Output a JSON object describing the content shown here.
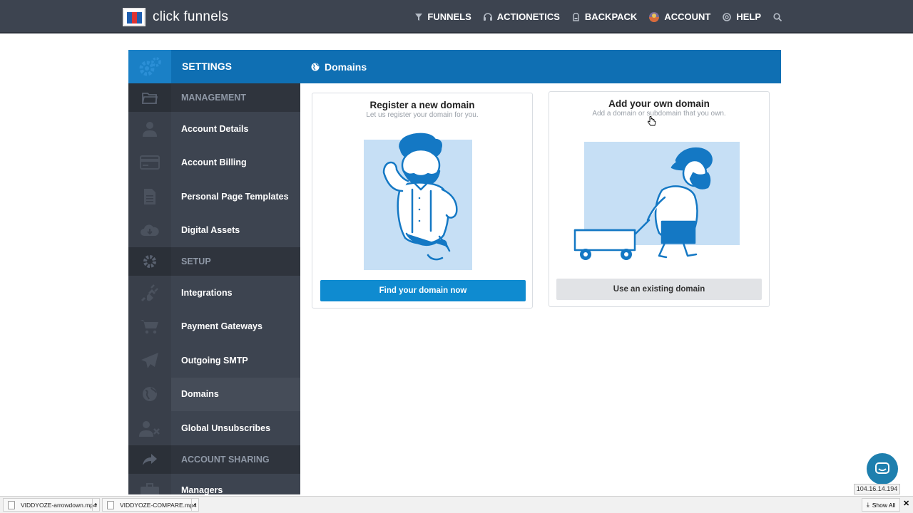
{
  "brand": {
    "logo_text": "click funnels"
  },
  "topnav": {
    "items": [
      {
        "label": "FUNNELS",
        "icon": "funnel-icon"
      },
      {
        "label": "ACTIONETICS",
        "icon": "headset-icon"
      },
      {
        "label": "BACKPACK",
        "icon": "backpack-icon"
      },
      {
        "label": "ACCOUNT",
        "icon": "avatar-icon"
      },
      {
        "label": "HELP",
        "icon": "lifebuoy-icon"
      }
    ],
    "search_icon": "search-icon"
  },
  "panel": {
    "title": "SETTINGS",
    "section_title": "Domains"
  },
  "sidebar": {
    "items": [
      {
        "label": "MANAGEMENT",
        "type": "section",
        "icon": "folder-icon"
      },
      {
        "label": "Account Details",
        "type": "item",
        "icon": "user-icon"
      },
      {
        "label": "Account Billing",
        "type": "item",
        "icon": "credit-card-icon"
      },
      {
        "label": "Personal Page Templates",
        "type": "item",
        "icon": "document-icon"
      },
      {
        "label": "Digital Assets",
        "type": "item",
        "icon": "cloud-download-icon"
      },
      {
        "label": "SETUP",
        "type": "section",
        "icon": "gear-icon"
      },
      {
        "label": "Integrations",
        "type": "item",
        "icon": "plug-icon"
      },
      {
        "label": "Payment Gateways",
        "type": "item",
        "icon": "cart-icon"
      },
      {
        "label": "Outgoing SMTP",
        "type": "item",
        "icon": "paper-plane-icon"
      },
      {
        "label": "Domains",
        "type": "item",
        "icon": "globe-icon",
        "active": true
      },
      {
        "label": "Global Unsubscribes",
        "type": "item",
        "icon": "user-remove-icon"
      },
      {
        "label": "ACCOUNT SHARING",
        "type": "section",
        "icon": "share-icon"
      },
      {
        "label": "Managers",
        "type": "item",
        "icon": "briefcase-icon"
      }
    ]
  },
  "cards": {
    "register": {
      "title": "Register a new domain",
      "subtitle": "Let us register your domain for you.",
      "button": "Find your domain now"
    },
    "own": {
      "title": "Add your own domain",
      "subtitle": "Add a domain or subdomain that you own.",
      "button": "Use an existing domain"
    }
  },
  "status": {
    "ip": "104.16.14.194"
  },
  "downloads": {
    "files": [
      "VIDDYOZE-arrowdown.mp4",
      "VIDDYOZE-COMPARE.mp4"
    ],
    "show_all": "Show All"
  },
  "colors": {
    "topbar": "#3d4450",
    "header_blue": "#0f6fb3",
    "sidebar": "#3d4450",
    "primary_button": "#0f8bd0",
    "illustration_bg": "#c6dff5",
    "illustration_stroke": "#1478c4"
  }
}
